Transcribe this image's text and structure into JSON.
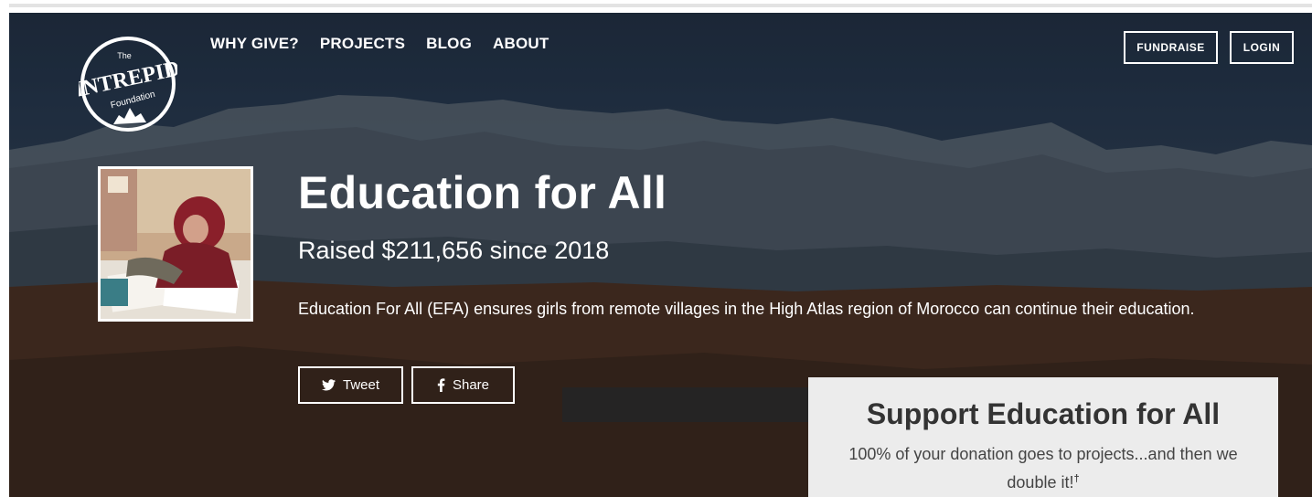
{
  "logo": {
    "top_text": "The",
    "main_text": "INTREPID",
    "bottom_text": "Foundation"
  },
  "nav": {
    "items": [
      {
        "label": "WHY GIVE?"
      },
      {
        "label": "PROJECTS"
      },
      {
        "label": "BLOG"
      },
      {
        "label": "ABOUT"
      }
    ]
  },
  "header_actions": {
    "fundraise_label": "FUNDRAISE",
    "login_label": "LOGIN"
  },
  "project": {
    "title": "Education for All",
    "raised": "Raised $211,656 since 2018",
    "description": "Education For All (EFA) ensures girls from remote villages in the High Atlas region of Morocco can continue their education."
  },
  "social": {
    "tweet_label": "Tweet",
    "share_label": "Share",
    "twitter_icon": "twitter-bird-icon",
    "facebook_icon": "facebook-f-icon"
  },
  "support": {
    "heading": "Support Education for All",
    "body": "100% of your donation goes to projects...and then we double it!",
    "footnote_mark": "†"
  },
  "colors": {
    "hero_overlay": "#233347",
    "panel_bg": "#ececec",
    "panel_text": "#333333",
    "white": "#ffffff"
  }
}
